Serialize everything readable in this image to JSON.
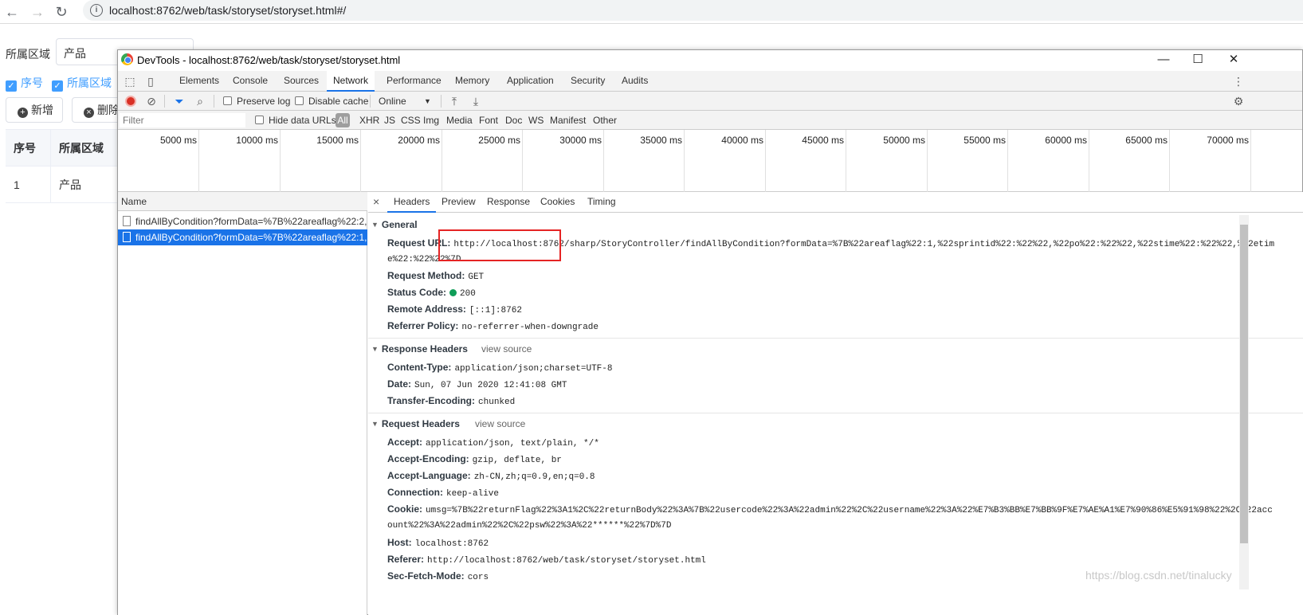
{
  "browser": {
    "url": "localhost:8762/web/task/storyset/storyset.html#/"
  },
  "page": {
    "area_label": "所属区域",
    "area_value": "产品",
    "checkbox_seq": "序号",
    "checkbox_area": "所属区域",
    "add_button": "新增",
    "delete_button": "删除",
    "table": {
      "headers": [
        "序号",
        "所属区域"
      ],
      "rows": [
        [
          "1",
          "产品"
        ]
      ]
    }
  },
  "devtools": {
    "title": "DevTools - localhost:8762/web/task/storyset/storyset.html",
    "tabs": [
      "Elements",
      "Console",
      "Sources",
      "Network",
      "Performance",
      "Memory",
      "Application",
      "Security",
      "Audits"
    ],
    "active_tab": "Network",
    "toolbar": {
      "preserve_log": "Preserve log",
      "disable_cache": "Disable cache",
      "throttle": "Online"
    },
    "filterbar": {
      "placeholder": "Filter",
      "hide_data_urls": "Hide data URLs",
      "all": "All",
      "types": [
        "XHR",
        "JS",
        "CSS",
        "Img",
        "Media",
        "Font",
        "Doc",
        "WS",
        "Manifest",
        "Other"
      ]
    },
    "timeline_ticks": [
      "5000 ms",
      "10000 ms",
      "15000 ms",
      "20000 ms",
      "25000 ms",
      "30000 ms",
      "35000 ms",
      "40000 ms",
      "45000 ms",
      "50000 ms",
      "55000 ms",
      "60000 ms",
      "65000 ms",
      "70000 ms"
    ],
    "name_header": "Name",
    "requests": [
      "findAllByCondition?formData=%7B%22areaflag%22:2,...",
      "findAllByCondition?formData=%7B%22areaflag%22:1,..."
    ],
    "selected_request_index": 1,
    "detail_tabs": [
      "Headers",
      "Preview",
      "Response",
      "Cookies",
      "Timing"
    ],
    "active_detail_tab": "Headers",
    "general": {
      "title": "General",
      "request_url_key": "Request URL:",
      "request_url_line1": "http://localhost:8762/sharp/StoryController/findAllByCondition?formData=%7B%22areaflag%22:1,%22sprintid%22:%22%22,%22po%22:%22%22,%22stime%22:%22%22,%22etim",
      "request_url_line2": "e%22:%22%22%7D",
      "request_method_key": "Request Method:",
      "request_method": "GET",
      "status_code_key": "Status Code:",
      "status_code": "200",
      "remote_address_key": "Remote Address:",
      "remote_address": "[::1]:8762",
      "referrer_policy_key": "Referrer Policy:",
      "referrer_policy": "no-referrer-when-downgrade"
    },
    "response_headers": {
      "title": "Response Headers",
      "view_source": "view source",
      "items": [
        {
          "k": "Content-Type:",
          "v": "application/json;charset=UTF-8"
        },
        {
          "k": "Date:",
          "v": "Sun, 07 Jun 2020 12:41:08 GMT"
        },
        {
          "k": "Transfer-Encoding:",
          "v": "chunked"
        }
      ]
    },
    "request_headers": {
      "title": "Request Headers",
      "view_source": "view source",
      "items": [
        {
          "k": "Accept:",
          "v": "application/json, text/plain, */*"
        },
        {
          "k": "Accept-Encoding:",
          "v": "gzip, deflate, br"
        },
        {
          "k": "Accept-Language:",
          "v": "zh-CN,zh;q=0.9,en;q=0.8"
        },
        {
          "k": "Connection:",
          "v": "keep-alive"
        }
      ],
      "cookie_key": "Cookie:",
      "cookie_line1": "umsg=%7B%22returnFlag%22%3A1%2C%22returnBody%22%3A%7B%22usercode%22%3A%22admin%22%2C%22username%22%3A%22%E7%B3%BB%E7%BB%9F%E7%AE%A1%E7%90%86%E5%91%98%22%2C%22acc",
      "cookie_line2": "ount%22%3A%22admin%22%2C%22psw%22%3A%22******%22%7D%7D",
      "items2": [
        {
          "k": "Host:",
          "v": "localhost:8762"
        },
        {
          "k": "Referer:",
          "v": "http://localhost:8762/web/task/storyset/storyset.html"
        },
        {
          "k": "Sec-Fetch-Mode:",
          "v": "cors"
        }
      ]
    }
  },
  "watermark": "https://blog.csdn.net/tinalucky",
  "colors": {
    "accent": "#1a73e8",
    "record": "#d93025",
    "status_ok": "#0f9d58",
    "highlight": "#e52424",
    "element_blue": "#409eff"
  }
}
